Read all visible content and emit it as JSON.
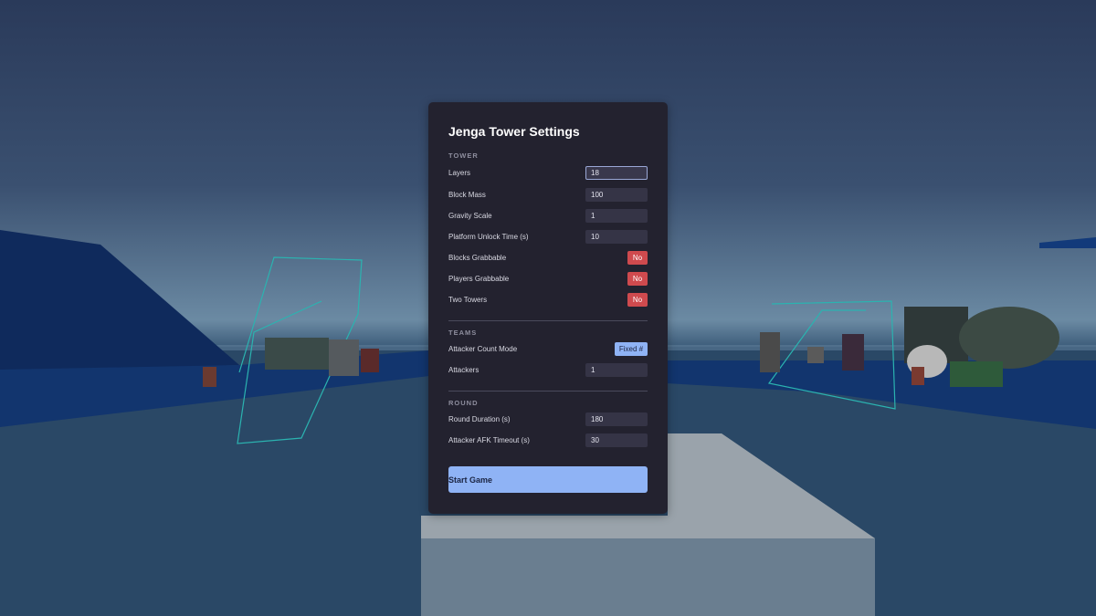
{
  "panel": {
    "title": "Jenga Tower Settings",
    "sections": {
      "tower": "TOWER",
      "teams": "TEAMS",
      "round": "ROUND"
    },
    "tower": {
      "layers_label": "Layers",
      "layers_value": "18",
      "block_mass_label": "Block Mass",
      "block_mass_value": "100",
      "gravity_scale_label": "Gravity Scale",
      "gravity_scale_value": "1",
      "platform_unlock_label": "Platform Unlock Time (s)",
      "platform_unlock_value": "10",
      "blocks_grabbable_label": "Blocks Grabbable",
      "blocks_grabbable_value": "No",
      "players_grabbable_label": "Players Grabbable",
      "players_grabbable_value": "No",
      "two_towers_label": "Two Towers",
      "two_towers_value": "No"
    },
    "teams": {
      "attacker_count_mode_label": "Attacker Count Mode",
      "attacker_count_mode_value": "Fixed #",
      "attackers_label": "Attackers",
      "attackers_value": "1"
    },
    "round": {
      "round_duration_label": "Round Duration (s)",
      "round_duration_value": "180",
      "afk_timeout_label": "Attacker AFK Timeout (s)",
      "afk_timeout_value": "30"
    },
    "start_label": "Start Game"
  },
  "colors": {
    "panel_bg": "#23222f",
    "accent": "#8fb3f5",
    "toggle_off": "#cf4a4e",
    "field_bg": "#353446"
  }
}
